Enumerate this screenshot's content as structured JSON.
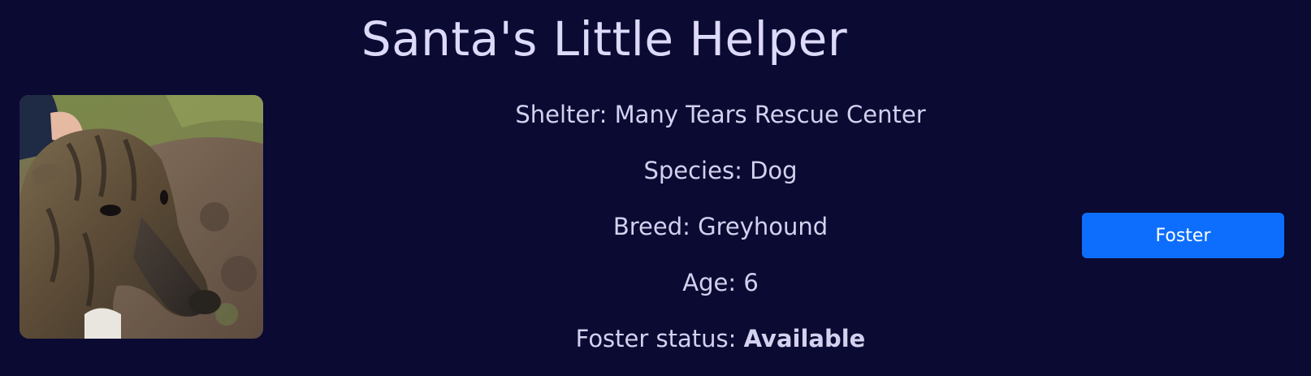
{
  "pet": {
    "name": "Santa's Little Helper",
    "photo_alt": "Brindle greyhound",
    "shelter_label": "Shelter:",
    "shelter": "Many Tears Rescue Center",
    "species_label": "Species:",
    "species": "Dog",
    "breed_label": "Breed:",
    "breed": "Greyhound",
    "age_label": "Age:",
    "age": "6",
    "status_label": "Foster status:",
    "status": "Available"
  },
  "actions": {
    "foster_label": "Foster"
  },
  "colors": {
    "background": "#0b0a33",
    "text": "#d3d1ee",
    "button": "#0d6efd"
  }
}
